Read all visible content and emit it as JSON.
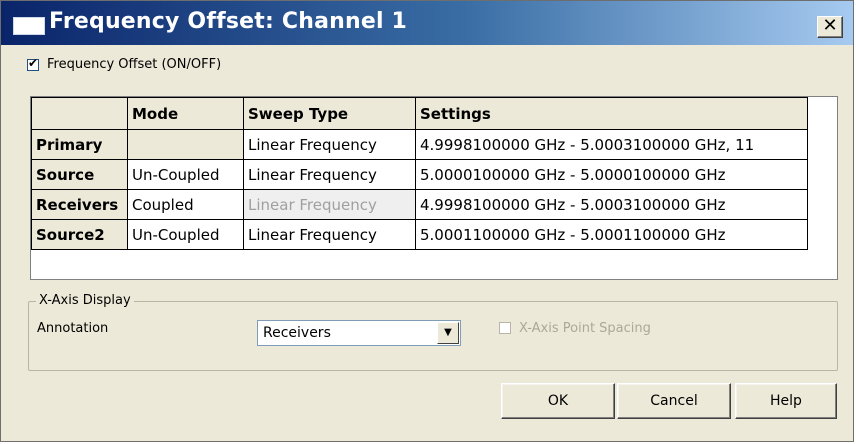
{
  "dialog": {
    "title": "Frequency Offset: Channel 1",
    "close_glyph": "✕"
  },
  "offset_toggle": {
    "label": "Frequency Offset (ON/OFF)",
    "checked": true
  },
  "table": {
    "headers": [
      "",
      "Mode",
      "Sweep Type",
      "Settings"
    ],
    "rows": [
      {
        "name": "Primary",
        "mode": "",
        "sweep": "Linear Frequency",
        "settings": "4.9998100000 GHz - 5.0003100000 GHz, 11"
      },
      {
        "name": "Source",
        "mode": "Un-Coupled",
        "sweep": "Linear Frequency",
        "settings": "5.0000100000 GHz - 5.0000100000 GHz"
      },
      {
        "name": "Receivers",
        "mode": "Coupled",
        "sweep": "Linear Frequency",
        "settings": "4.9998100000 GHz - 5.0003100000 GHz"
      },
      {
        "name": "Source2",
        "mode": "Un-Coupled",
        "sweep": "Linear Frequency",
        "settings": "5.0001100000 GHz - 5.0001100000 GHz"
      }
    ]
  },
  "xaxis": {
    "group_title": "X-Axis Display",
    "annotation_label": "Annotation",
    "annotation_value": "Receivers",
    "point_spacing_label": "X-Axis Point Spacing",
    "point_spacing_checked": false
  },
  "buttons": {
    "ok": "OK",
    "cancel": "Cancel",
    "help": "Help"
  },
  "colors": {
    "title_bar_start": "#0a246a",
    "title_bar_end": "#a6caf0",
    "dialog_bg": "#ece9d8",
    "disabled_text": "#a0a0a0"
  }
}
